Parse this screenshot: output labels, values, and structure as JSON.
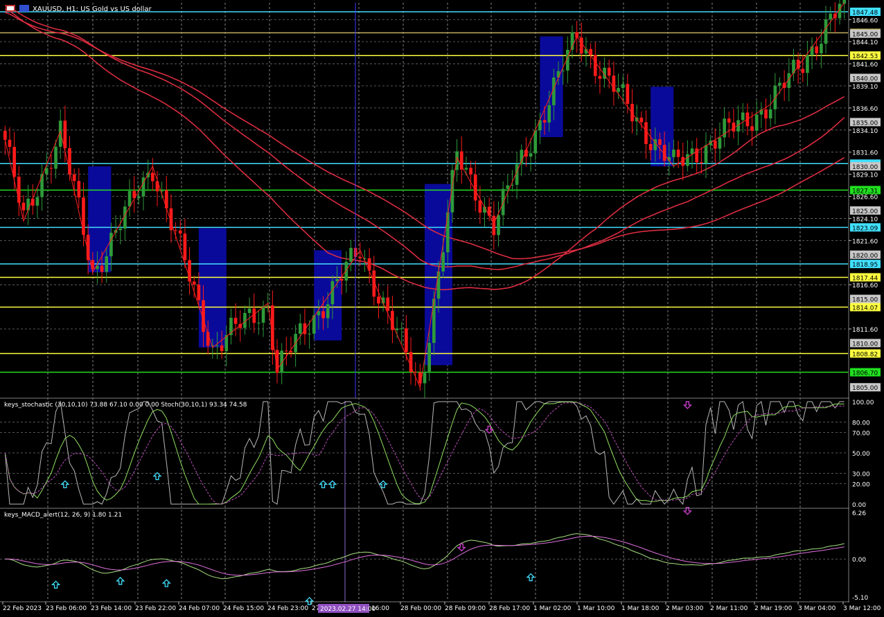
{
  "window": {
    "symbol_title": "XAUUSD, H1:  US Gold vs US dollar"
  },
  "colors": {
    "background": "#000000",
    "grid": "#c0c0c0",
    "bull": "#2e9a3a",
    "bear": "#ff1a1a",
    "zigzag": "#ff2020",
    "ma_red": "#dc2c40",
    "ma_blue": "#3ab0ff",
    "box": "#0a0a9a",
    "level_yellow": "#ffff40",
    "level_cyan": "#40e0ff",
    "level_green": "#20e020",
    "stoch_main": "#b8b8b8",
    "stoch_signal": "#c050c0",
    "stoch_k": "#90e060",
    "macd_main": "#a8e080",
    "macd_signal": "#e070e0",
    "arrow_up": "#40e0ff",
    "arrow_down": "#d040d0"
  },
  "price_axis": {
    "min": 1804.0,
    "max": 1848.5,
    "ticks": [
      "1846.60",
      "1844.10",
      "1841.60",
      "1839.10",
      "1836.60",
      "1834.10",
      "1831.60",
      "1829.10",
      "1826.60",
      "1824.10",
      "1821.60",
      "1816.60",
      "1811.60"
    ],
    "tick_values": [
      1846.6,
      1844.1,
      1841.6,
      1839.1,
      1836.6,
      1834.1,
      1831.6,
      1829.1,
      1826.6,
      1824.1,
      1821.6,
      1816.6,
      1811.6
    ],
    "grey_labels": [
      {
        "text": "1845.00",
        "value": 1845.0
      },
      {
        "text": "1840.00",
        "value": 1840.0
      },
      {
        "text": "1835.00",
        "value": 1835.0
      },
      {
        "text": "1830.00",
        "value": 1830.0
      },
      {
        "text": "1825.00",
        "value": 1825.0
      },
      {
        "text": "1820.00",
        "value": 1820.0
      },
      {
        "text": "1815.00",
        "value": 1815.0
      },
      {
        "text": "1810.00",
        "value": 1810.0
      },
      {
        "text": "1805.00",
        "value": 1805.0
      }
    ]
  },
  "levels": [
    {
      "text": "1847.48",
      "value": 1847.48,
      "kind": "cyan"
    },
    {
      "text": "1842.53",
      "value": 1842.53,
      "kind": "yellow"
    },
    {
      "text": "1845.00",
      "value": 1845.1,
      "kind": "yellow_dim"
    },
    {
      "text": "1830.30",
      "value": 1830.3,
      "kind": "cyan"
    },
    {
      "text": "1827.31",
      "value": 1827.31,
      "kind": "green"
    },
    {
      "text": "1823.09",
      "value": 1823.09,
      "kind": "cyan"
    },
    {
      "text": "1818.95",
      "value": 1818.95,
      "kind": "cyan"
    },
    {
      "text": "1817.44",
      "value": 1817.44,
      "kind": "yellow"
    },
    {
      "text": "1814.07",
      "value": 1814.07,
      "kind": "yellow"
    },
    {
      "text": "1808.82",
      "value": 1808.82,
      "kind": "yellow"
    },
    {
      "text": "1806.70",
      "value": 1806.7,
      "kind": "green"
    }
  ],
  "stochastic": {
    "label": "keys_stochastic (30,10,10) 73.88 67.10 0.00 0.00 Stoch(30,10,1) 93.34 74.58",
    "ticks": [
      {
        "text": "100.00",
        "value": 100
      },
      {
        "text": "80.00",
        "value": 80
      },
      {
        "text": "70.00",
        "value": 70
      },
      {
        "text": "50.00",
        "value": 50
      },
      {
        "text": "30.00",
        "value": 30
      },
      {
        "text": "20.00",
        "value": 20
      },
      {
        "text": "0.00",
        "value": 0
      }
    ]
  },
  "macd": {
    "label": "keys_MACD_alert(12, 26, 9) 1.80 1.21",
    "ticks": [
      {
        "text": "6.26",
        "value": 6.26
      },
      {
        "text": "0.00",
        "value": 0
      },
      {
        "text": "-5.10",
        "value": -5.1
      }
    ]
  },
  "time_axis": {
    "labels": [
      "22 Feb 2023",
      "23 Feb 06:00",
      "23 Feb 14:00",
      "23 Feb 22:00",
      "24 Feb 07:00",
      "24 Feb 15:00",
      "24 Feb 23:00",
      "27",
      "28 Feb 00:00",
      "28 Feb 09:00",
      "28 Feb 17:00",
      "1 Mar 02:00",
      "1 Mar 10:00",
      "1 Mar 18:00",
      "2 Mar 03:00",
      "2 Mar 11:00",
      "2 Mar 19:00",
      "3 Mar 04:00",
      "3 Mar 12:00"
    ],
    "crosshair_label": "2023.02.27 14:00",
    "crosshair_tail": "16:00"
  },
  "zigzag_points": [
    [
      0,
      1833.0
    ],
    [
      4,
      1823.8
    ],
    [
      12,
      1834.0
    ],
    [
      19,
      1818.0
    ],
    [
      32,
      1830.0
    ],
    [
      45,
      1809.5
    ],
    [
      57,
      1814.5
    ],
    [
      59,
      1807.0
    ],
    [
      77,
      1820.5
    ],
    [
      90,
      1805.0
    ],
    [
      98,
      1831.0
    ],
    [
      106,
      1823.5
    ],
    [
      124,
      1844.7
    ],
    [
      136,
      1836.0
    ],
    [
      145,
      1830.0
    ],
    [
      166,
      1837.0
    ],
    [
      182,
      1848.5
    ]
  ],
  "boxes": [
    {
      "from": 18.5,
      "to": 23.5,
      "high": 1830.0,
      "low": 1818.0
    },
    {
      "from": 42.5,
      "to": 48.5,
      "high": 1823.0,
      "low": 1809.5
    },
    {
      "from": 67.5,
      "to": 73.5,
      "high": 1820.5,
      "low": 1810.3
    },
    {
      "from": 91.5,
      "to": 97.5,
      "high": 1828.0,
      "low": 1807.5
    },
    {
      "from": 116.5,
      "to": 121.5,
      "high": 1844.7,
      "low": 1833.3
    },
    {
      "from": 140.5,
      "to": 145.5,
      "high": 1839.0,
      "low": 1830.0
    }
  ]
}
